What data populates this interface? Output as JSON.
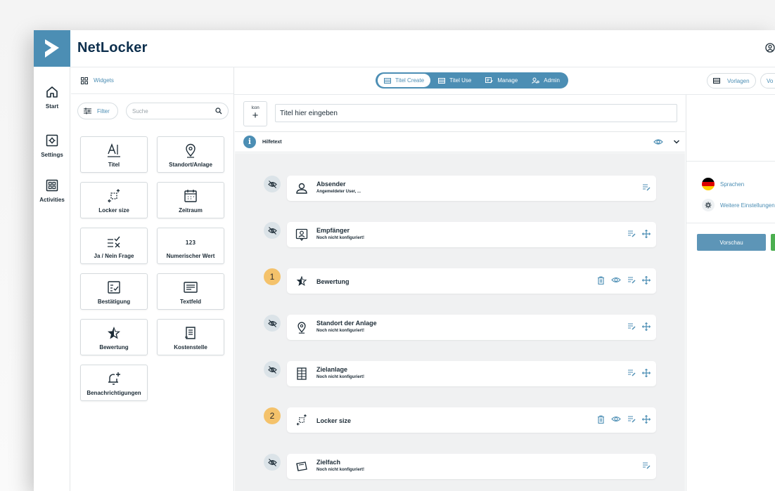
{
  "app": {
    "brand": "NetLocker",
    "accent": "#4c8eb4"
  },
  "rail": [
    {
      "label": "Start",
      "icon": "home-icon"
    },
    {
      "label": "Settings",
      "icon": "settings-icon"
    },
    {
      "label": "Activities",
      "icon": "grid-icon"
    }
  ],
  "widgets_panel": {
    "header": "Widgets",
    "filter_label": "Filter",
    "search_placeholder": "Suche",
    "tiles": [
      {
        "label": "Titel",
        "icon": "text-icon"
      },
      {
        "label": "Standort/Anlage",
        "icon": "location-pin-icon"
      },
      {
        "label": "Locker size",
        "icon": "resize-icon"
      },
      {
        "label": "Zeitraum",
        "icon": "calendar-icon"
      },
      {
        "label": "Ja / Nein Frage",
        "icon": "yes-no-icon"
      },
      {
        "label": "Numerischer Wert",
        "icon": "numeric-icon"
      },
      {
        "label": "Bestätigung",
        "icon": "checkbox-icon"
      },
      {
        "label": "Textfeld",
        "icon": "textfield-icon"
      },
      {
        "label": "Bewertung",
        "icon": "star-icon"
      },
      {
        "label": "Kostenstelle",
        "icon": "document-icon"
      },
      {
        "label": "Benachrichtigungen",
        "icon": "bell-plus-icon"
      }
    ]
  },
  "tabs": [
    {
      "label": "Titel Create",
      "active": true
    },
    {
      "label": "Titel Use",
      "active": false
    },
    {
      "label": "Manage",
      "active": false
    },
    {
      "label": "Admin",
      "active": false
    }
  ],
  "top_right": {
    "vorlagen": "Vorlagen",
    "cut_pill": "Vo"
  },
  "form": {
    "icon_label": "Icon",
    "title_placeholder": "Titel hier eingeben",
    "hilfetext": "Hilfetext"
  },
  "fields": [
    {
      "title": "Absender",
      "subtitle": "Angemeldeter User, ...",
      "badge": "hidden",
      "icon": "user-icon",
      "actions": [
        "edit"
      ]
    },
    {
      "title": "Empfänger",
      "subtitle": "Noch nicht konfiguriert!",
      "badge": "hidden",
      "icon": "contact-icon",
      "actions": [
        "edit",
        "move"
      ]
    },
    {
      "title": "Bewertung",
      "subtitle": "",
      "badge": "1",
      "icon": "star-icon",
      "actions": [
        "delete",
        "visible",
        "edit",
        "move"
      ]
    },
    {
      "title": "Standort der Anlage",
      "subtitle": "Noch nicht konfiguriert!",
      "badge": "hidden",
      "icon": "location-pin-icon",
      "actions": [
        "edit",
        "move"
      ]
    },
    {
      "title": "Zielanlage",
      "subtitle": "Noch nicht konfiguriert!",
      "badge": "hidden",
      "icon": "locker-grid-icon",
      "actions": [
        "edit",
        "move"
      ]
    },
    {
      "title": "Locker size",
      "subtitle": "",
      "badge": "2",
      "icon": "resize-icon",
      "actions": [
        "delete",
        "visible",
        "edit",
        "move"
      ]
    },
    {
      "title": "Zielfach",
      "subtitle": "Noch nicht konfiguriert!",
      "badge": "hidden",
      "icon": "compartment-icon",
      "actions": [
        "edit"
      ]
    }
  ],
  "right_panel": {
    "sprachen": "Sprachen",
    "weitere": "Weitere Einstellungen",
    "vorschau": "Vorschau"
  }
}
